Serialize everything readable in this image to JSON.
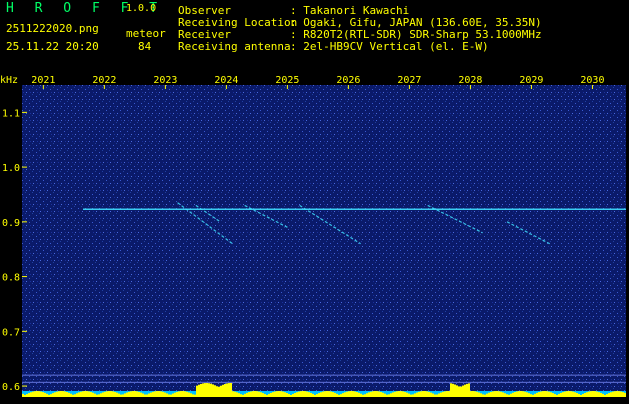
{
  "header": {
    "app_title": "H R O F F T",
    "version": "1.0.0",
    "filename": "2511222020.png",
    "datetime": "25.11.22 20:20",
    "meteor_label": "meteor",
    "meteor_count": "84",
    "fields": [
      {
        "key": "Observer",
        "value": ": Takanori Kawachi"
      },
      {
        "key": "Receiving Location",
        "value": ": Ogaki, Gifu, JAPAN (136.60E, 35.35N)"
      },
      {
        "key": "Receiver",
        "value": ": R820T2(RTL-SDR) SDR-Sharp 53.1000MHz"
      },
      {
        "key": "Receiving antenna",
        "value": ": 2el-HB9CV Vertical (el. E-W)"
      }
    ]
  },
  "colors": {
    "background": "#000000",
    "label": "#ffff00",
    "title": "#00ff66",
    "plot_bg": "#0a1a6a",
    "trace": "#40e0ff",
    "level_bar": "#ffff00",
    "level_base": "#00c0ff"
  },
  "chart_data": {
    "type": "heatmap",
    "ylabel": "kHz",
    "x_ticks": [
      "2021",
      "2022",
      "2023",
      "2024",
      "2025",
      "2026",
      "2027",
      "2028",
      "2029",
      "2030"
    ],
    "y_ticks": [
      "1.1",
      "1.0",
      "0.9",
      "0.8",
      "0.7",
      "0.6"
    ],
    "y_tick_values": [
      1.1,
      1.0,
      0.9,
      0.8,
      0.7,
      0.6
    ],
    "ylim": [
      0.58,
      1.15
    ],
    "carrier_khz": 0.923,
    "meteor_traces": [
      {
        "x_start": 2023.2,
        "x_end": 2024.1,
        "y_start": 0.935,
        "y_end": 0.86
      },
      {
        "x_start": 2023.5,
        "x_end": 2023.9,
        "y_start": 0.93,
        "y_end": 0.9
      },
      {
        "x_start": 2024.3,
        "x_end": 2025.0,
        "y_start": 0.93,
        "y_end": 0.89
      },
      {
        "x_start": 2025.2,
        "x_end": 2026.2,
        "y_start": 0.93,
        "y_end": 0.86
      },
      {
        "x_start": 2027.3,
        "x_end": 2028.2,
        "y_start": 0.93,
        "y_end": 0.88
      },
      {
        "x_start": 2028.6,
        "x_end": 2029.3,
        "y_start": 0.9,
        "y_end": 0.86
      }
    ]
  }
}
